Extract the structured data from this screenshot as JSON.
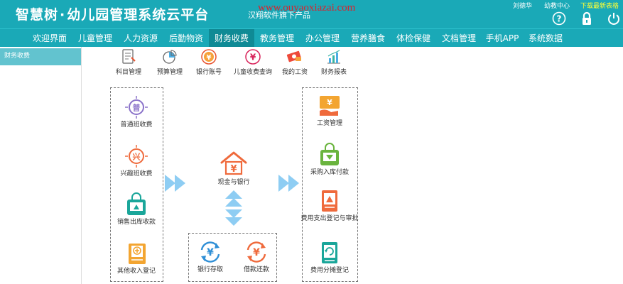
{
  "header": {
    "brand": "智慧树",
    "brand_dot": "·",
    "title": "幼儿园管理系统云平台",
    "subtitle": "汉翔软件旗下产品",
    "watermark": "www.ouyaoxiazai.com",
    "user_name": "刘德华",
    "role": "幼教中心",
    "download_link": "下载最新表格",
    "icons": [
      "help-icon",
      "lock-icon",
      "power-icon"
    ]
  },
  "nav": {
    "items": [
      "欢迎界面",
      "儿童管理",
      "人力资源",
      "后勤物资",
      "财务收费",
      "教务管理",
      "办公管理",
      "营养膳食",
      "体检保健",
      "文档管理",
      "手机APP",
      "系统数据"
    ],
    "active_index": 4
  },
  "sidebar": {
    "items": [
      {
        "label": "财务收费"
      }
    ]
  },
  "toolbar": {
    "items": [
      {
        "label": "科目管理",
        "icon": "document-list-icon"
      },
      {
        "label": "预算管理",
        "icon": "pie-chart-icon"
      },
      {
        "label": "银行账号",
        "icon": "yuan-coin-icon"
      },
      {
        "label": "儿童收费查询",
        "icon": "yuan-coin-icon"
      },
      {
        "label": "我的工资",
        "icon": "money-bill-icon"
      },
      {
        "label": "财务报表",
        "icon": "bar-chart-icon"
      }
    ]
  },
  "flow": {
    "left": [
      {
        "label": "普通班收费",
        "icon": "pu-badge-icon"
      },
      {
        "label": "兴趣班收费",
        "icon": "yuan-badge-icon"
      },
      {
        "label": "销售出库收款",
        "icon": "shopping-bag-icon"
      },
      {
        "label": "其他收入登记",
        "icon": "register-form-icon"
      }
    ],
    "center": {
      "label": "现金与银行",
      "icon": "house-yuan-icon"
    },
    "bottom": [
      {
        "label": "银行存取",
        "icon": "yuan-cycle-icon"
      },
      {
        "label": "借款还款",
        "icon": "yuan-cycle-icon"
      }
    ],
    "right": [
      {
        "label": "工资管理",
        "icon": "salary-icon"
      },
      {
        "label": "采购入库付款",
        "icon": "purchase-bag-icon"
      },
      {
        "label": "费用支出登记与审批",
        "icon": "expense-doc-icon"
      },
      {
        "label": "费用分摊登记",
        "icon": "allocation-doc-icon"
      }
    ]
  },
  "colors": {
    "header_bg": "#1aa9b7",
    "nav_active": "#0f8a95",
    "sidebar_active": "#62c3cf",
    "flow_arrow": "#8ecdf3",
    "watermark": "#d6242f",
    "download_link": "#ffff33"
  }
}
